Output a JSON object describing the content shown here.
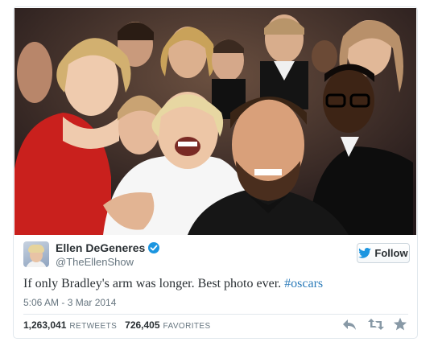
{
  "tweet": {
    "author_name": "Ellen DeGeneres",
    "author_handle": "@TheEllenShow",
    "follow_label": "Follow",
    "text_main": "If only Bradley's arm was longer. Best photo ever. ",
    "hashtag": "#oscars",
    "timestamp": "5:06 AM - 3 Mar 2014",
    "retweets_count": "1,263,041",
    "retweets_label": "RETWEETS",
    "favorites_count": "726,405",
    "favorites_label": "FAVORITES"
  },
  "icons": {
    "verified": "verified-badge-icon",
    "follow_bird": "twitter-bird-icon",
    "reply": "reply-icon",
    "retweet": "retweet-icon",
    "favorite": "star-icon"
  },
  "colors": {
    "accent_blue": "#1b95e0",
    "hashtag_blue": "#2b7bb9",
    "muted_gray": "#66757f",
    "action_gray": "#8899a6"
  }
}
